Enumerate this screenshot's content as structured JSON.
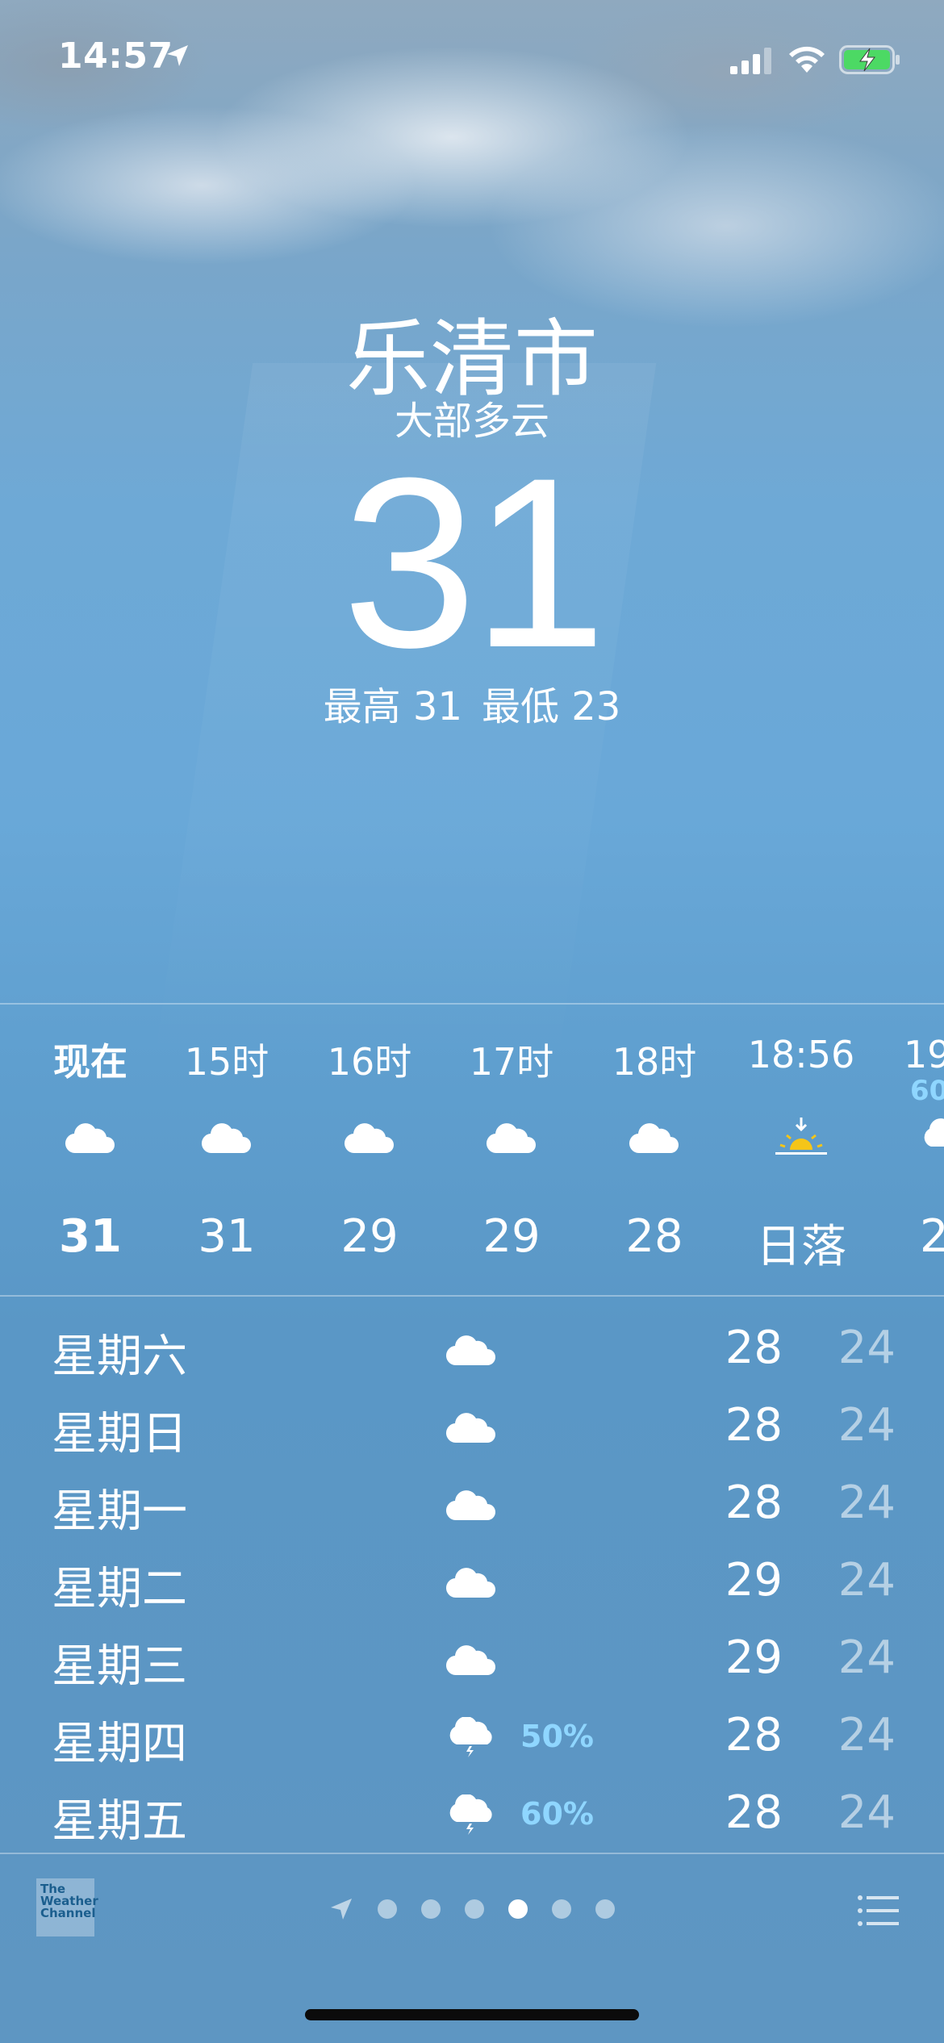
{
  "status_bar": {
    "time": "14:57",
    "icons": [
      "location-arrow-icon",
      "cellular-signal-icon",
      "wifi-icon",
      "battery-charging-icon"
    ]
  },
  "weather": {
    "city": "乐清市",
    "condition": "大部多云",
    "temperature": "31",
    "high": "最高 31",
    "low": "最低 23"
  },
  "hourly": [
    {
      "time": "现在",
      "icon": "cloud-icon",
      "temp": "31",
      "precip": ""
    },
    {
      "time": "15时",
      "icon": "cloud-icon",
      "temp": "31",
      "precip": ""
    },
    {
      "time": "16时",
      "icon": "cloud-icon",
      "temp": "29",
      "precip": ""
    },
    {
      "time": "17时",
      "icon": "cloud-icon",
      "temp": "29",
      "precip": ""
    },
    {
      "time": "18时",
      "icon": "cloud-icon",
      "temp": "28",
      "precip": ""
    },
    {
      "time": "18:56",
      "icon": "sunset-icon",
      "temp": "日落",
      "precip": ""
    },
    {
      "time": "19",
      "icon": "thunderstorm-icon",
      "temp": "2",
      "precip": "60"
    }
  ],
  "daily": [
    {
      "day": "星期六",
      "icon": "cloud-icon",
      "precip": "",
      "high": "28",
      "low": "24"
    },
    {
      "day": "星期日",
      "icon": "cloud-icon",
      "precip": "",
      "high": "28",
      "low": "24"
    },
    {
      "day": "星期一",
      "icon": "cloud-icon",
      "precip": "",
      "high": "28",
      "low": "24"
    },
    {
      "day": "星期二",
      "icon": "cloud-icon",
      "precip": "",
      "high": "29",
      "low": "24"
    },
    {
      "day": "星期三",
      "icon": "cloud-icon",
      "precip": "",
      "high": "29",
      "low": "24"
    },
    {
      "day": "星期四",
      "icon": "thunderstorm-icon",
      "precip": "50%",
      "high": "28",
      "low": "24"
    },
    {
      "day": "星期五",
      "icon": "thunderstorm-icon",
      "precip": "60%",
      "high": "28",
      "low": "24"
    }
  ],
  "bottom_bar": {
    "logo_lines": [
      "The",
      "Weather",
      "Channel"
    ],
    "page_count": 6,
    "active_page": 3
  },
  "colors": {
    "precip_blue": "#8fd6ff",
    "sun_yellow": "#f5c518"
  }
}
